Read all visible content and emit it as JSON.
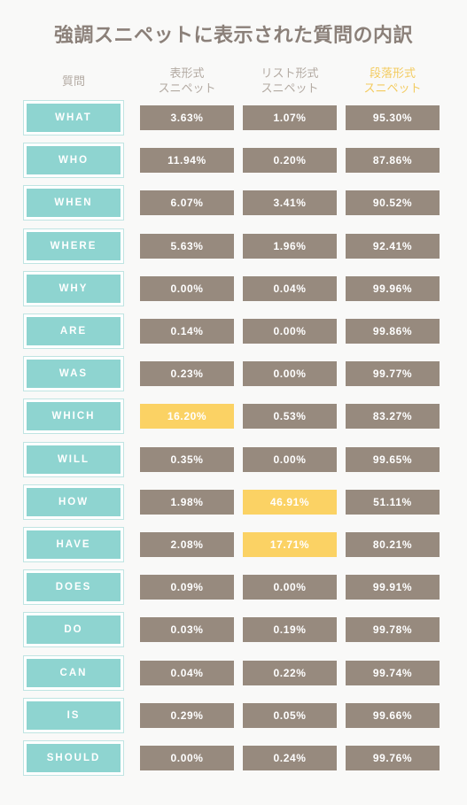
{
  "title": "強調スニペットに表示された質問の内訳",
  "colors": {
    "background": "#f9f9f8",
    "title": "#8b8079",
    "teal_fill": "#8ed4d0",
    "teal_border": "#bfe4e2",
    "bar": "#978a7e",
    "highlight": "#fbd264",
    "header_text": "#b3aaa2",
    "header_gold": "#f3cb5f"
  },
  "headers": {
    "question": "質問",
    "table_snippet": {
      "line1": "表形式",
      "line2": "スニペット"
    },
    "list_snippet": {
      "line1": "リスト形式",
      "line2": "スニペット"
    },
    "paragraph_snippet": {
      "line1": "段落形式",
      "line2": "スニペット"
    }
  },
  "chart_data": {
    "type": "table",
    "title": "強調スニペットに表示された質問の内訳",
    "categories": [
      "WHAT",
      "WHO",
      "WHEN",
      "WHERE",
      "WHY",
      "ARE",
      "WAS",
      "WHICH",
      "WILL",
      "HOW",
      "HAVE",
      "DOES",
      "DO",
      "CAN",
      "IS",
      "SHOULD"
    ],
    "series": [
      {
        "name": "表形式スニペット",
        "values": [
          3.63,
          11.94,
          6.07,
          5.63,
          0.0,
          0.14,
          0.23,
          16.2,
          0.35,
          1.98,
          2.08,
          0.09,
          0.03,
          0.04,
          0.29,
          0.0
        ]
      },
      {
        "name": "リスト形式スニペット",
        "values": [
          1.07,
          0.2,
          3.41,
          1.96,
          0.04,
          0.0,
          0.0,
          0.53,
          0.0,
          46.91,
          17.71,
          0.0,
          0.19,
          0.22,
          0.05,
          0.24
        ]
      },
      {
        "name": "段落形式スニペット",
        "values": [
          95.3,
          87.86,
          90.52,
          92.41,
          99.96,
          99.86,
          99.77,
          83.27,
          99.65,
          51.11,
          80.21,
          99.91,
          99.78,
          99.74,
          99.66,
          99.76
        ]
      }
    ],
    "unit": "%",
    "highlighted": [
      {
        "row": "WHICH",
        "column": "表形式スニペット",
        "value": "16.20%"
      },
      {
        "row": "HOW",
        "column": "リスト形式スニペット",
        "value": "46.91%"
      },
      {
        "row": "HAVE",
        "column": "リスト形式スニペット",
        "value": "17.71%"
      }
    ]
  },
  "rows": [
    {
      "label": "WHAT",
      "table": "3.63%",
      "list": "1.07%",
      "paragraph": "95.30%",
      "hl_table": false,
      "hl_list": false,
      "hl_paragraph": false
    },
    {
      "label": "WHO",
      "table": "11.94%",
      "list": "0.20%",
      "paragraph": "87.86%",
      "hl_table": false,
      "hl_list": false,
      "hl_paragraph": false
    },
    {
      "label": "WHEN",
      "table": "6.07%",
      "list": "3.41%",
      "paragraph": "90.52%",
      "hl_table": false,
      "hl_list": false,
      "hl_paragraph": false
    },
    {
      "label": "WHERE",
      "table": "5.63%",
      "list": "1.96%",
      "paragraph": "92.41%",
      "hl_table": false,
      "hl_list": false,
      "hl_paragraph": false
    },
    {
      "label": "WHY",
      "table": "0.00%",
      "list": "0.04%",
      "paragraph": "99.96%",
      "hl_table": false,
      "hl_list": false,
      "hl_paragraph": false
    },
    {
      "label": "ARE",
      "table": "0.14%",
      "list": "0.00%",
      "paragraph": "99.86%",
      "hl_table": false,
      "hl_list": false,
      "hl_paragraph": false
    },
    {
      "label": "WAS",
      "table": "0.23%",
      "list": "0.00%",
      "paragraph": "99.77%",
      "hl_table": false,
      "hl_list": false,
      "hl_paragraph": false
    },
    {
      "label": "WHICH",
      "table": "16.20%",
      "list": "0.53%",
      "paragraph": "83.27%",
      "hl_table": true,
      "hl_list": false,
      "hl_paragraph": false
    },
    {
      "label": "WILL",
      "table": "0.35%",
      "list": "0.00%",
      "paragraph": "99.65%",
      "hl_table": false,
      "hl_list": false,
      "hl_paragraph": false
    },
    {
      "label": "HOW",
      "table": "1.98%",
      "list": "46.91%",
      "paragraph": "51.11%",
      "hl_table": false,
      "hl_list": true,
      "hl_paragraph": false
    },
    {
      "label": "HAVE",
      "table": "2.08%",
      "list": "17.71%",
      "paragraph": "80.21%",
      "hl_table": false,
      "hl_list": true,
      "hl_paragraph": false
    },
    {
      "label": "DOES",
      "table": "0.09%",
      "list": "0.00%",
      "paragraph": "99.91%",
      "hl_table": false,
      "hl_list": false,
      "hl_paragraph": false
    },
    {
      "label": "DO",
      "table": "0.03%",
      "list": "0.19%",
      "paragraph": "99.78%",
      "hl_table": false,
      "hl_list": false,
      "hl_paragraph": false
    },
    {
      "label": "CAN",
      "table": "0.04%",
      "list": "0.22%",
      "paragraph": "99.74%",
      "hl_table": false,
      "hl_list": false,
      "hl_paragraph": false
    },
    {
      "label": "IS",
      "table": "0.29%",
      "list": "0.05%",
      "paragraph": "99.66%",
      "hl_table": false,
      "hl_list": false,
      "hl_paragraph": false
    },
    {
      "label": "SHOULD",
      "table": "0.00%",
      "list": "0.24%",
      "paragraph": "99.76%",
      "hl_table": false,
      "hl_list": false,
      "hl_paragraph": false
    }
  ]
}
